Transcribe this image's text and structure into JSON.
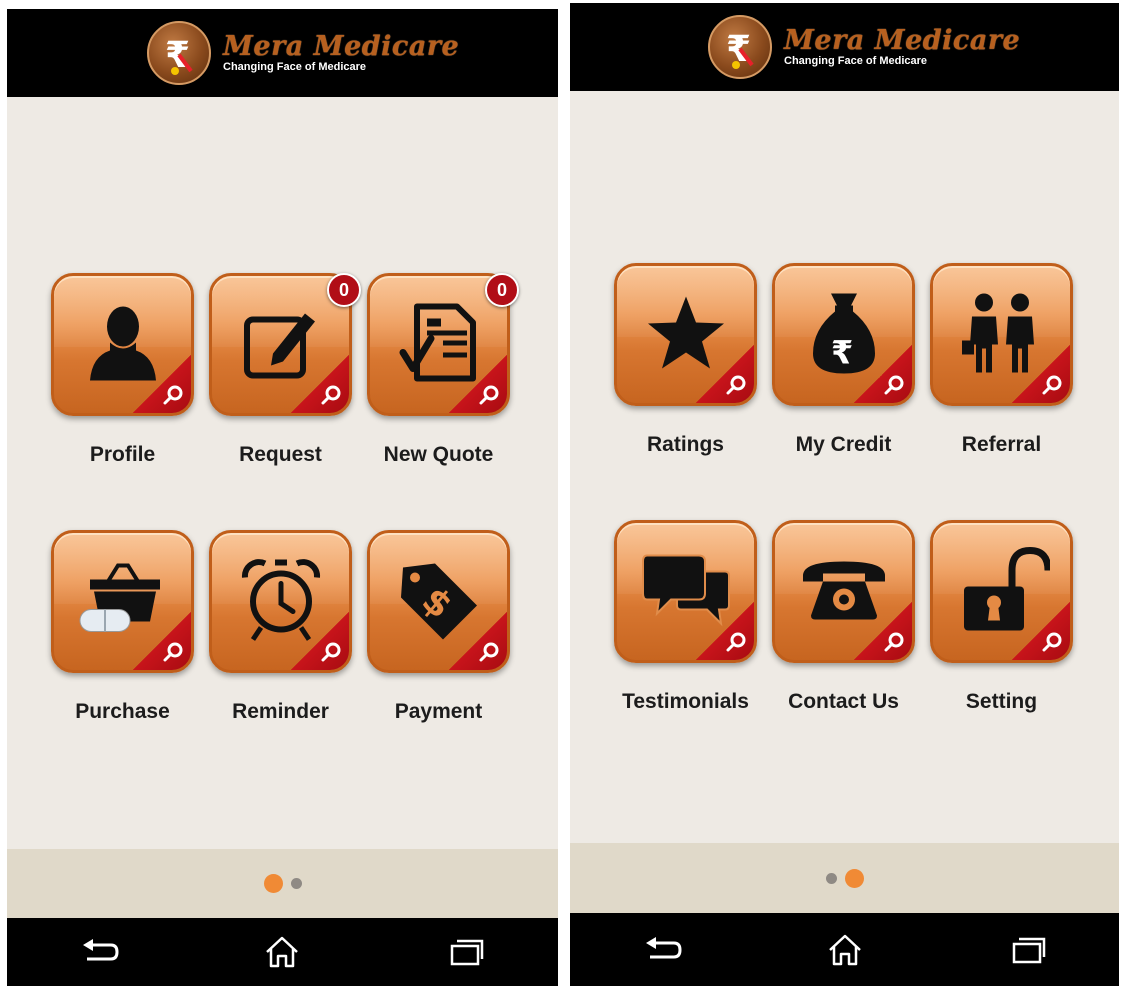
{
  "app": {
    "brand": "Mera Medicare",
    "tagline": "Changing Face of Medicare"
  },
  "colors": {
    "accent": "#ec9450",
    "badge": "#b10e17",
    "header_bg": "#000000",
    "pager_bg": "#e0d9c9",
    "active_dot": "#f08a35"
  },
  "screens": [
    {
      "active_page": 0,
      "tiles": [
        {
          "label": "Profile",
          "icon": "person-icon"
        },
        {
          "label": "Request",
          "icon": "edit-icon",
          "badge": "0"
        },
        {
          "label": "New Quote",
          "icon": "quote-document-icon",
          "badge": "0"
        },
        {
          "label": "Purchase",
          "icon": "basket-pills-icon"
        },
        {
          "label": "Reminder",
          "icon": "alarm-clock-icon"
        },
        {
          "label": "Payment",
          "icon": "price-tag-icon"
        }
      ]
    },
    {
      "active_page": 1,
      "tiles": [
        {
          "label": "Ratings",
          "icon": "star-icon"
        },
        {
          "label": "My Credit",
          "icon": "money-bag-icon"
        },
        {
          "label": "Referral",
          "icon": "referral-people-icon"
        },
        {
          "label": "Testimonials",
          "icon": "chat-bubbles-icon"
        },
        {
          "label": "Contact Us",
          "icon": "telephone-icon"
        },
        {
          "label": "Setting",
          "icon": "padlock-icon"
        }
      ]
    }
  ],
  "nav": [
    "back-icon",
    "home-icon",
    "recents-icon"
  ]
}
